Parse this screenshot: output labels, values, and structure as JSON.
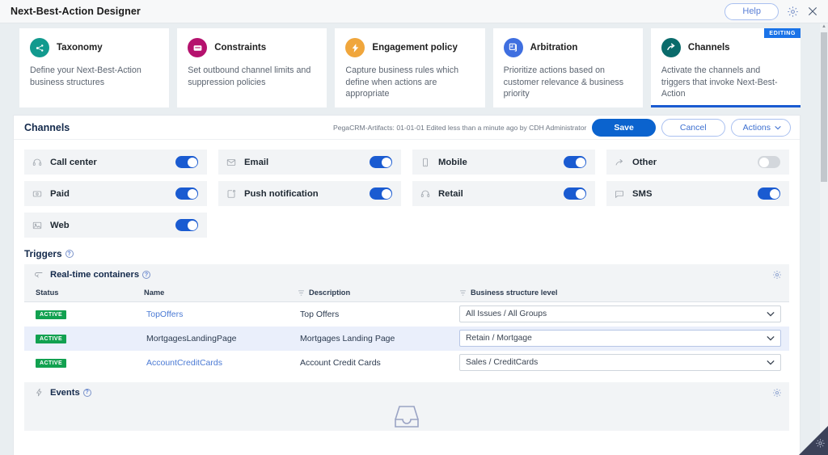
{
  "window": {
    "title": "Next-Best-Action Designer",
    "help_label": "Help",
    "settings_icon": "gear-icon",
    "close_icon": "close-icon"
  },
  "cards": [
    {
      "id": "taxonomy",
      "title": "Taxonomy",
      "description": "Define your Next-Best-Action business structures",
      "icon": "taxonomy-icon",
      "color": "#129a8e",
      "active": false,
      "badge": ""
    },
    {
      "id": "constraints",
      "title": "Constraints",
      "description": "Set outbound channel limits and suppression policies",
      "icon": "constraints-icon",
      "color": "#b5126e",
      "active": false,
      "badge": ""
    },
    {
      "id": "engagement-policy",
      "title": "Engagement policy",
      "description": "Capture business rules which define when actions are appropriate",
      "icon": "bolt-icon",
      "color": "#f0a63c",
      "active": false,
      "badge": ""
    },
    {
      "id": "arbitration",
      "title": "Arbitration",
      "description": "Prioritize actions based on customer relevance & business priority",
      "icon": "arbitration-icon",
      "color": "#3f6fe0",
      "active": false,
      "badge": ""
    },
    {
      "id": "channels",
      "title": "Channels",
      "description": "Activate the channels and triggers that invoke Next-Best-Action",
      "icon": "channels-arrow-icon",
      "color": "#0a6b6b",
      "active": true,
      "badge": "EDITING"
    }
  ],
  "panel": {
    "title": "Channels",
    "meta": "PegaCRM-Artifacts: 01-01-01   Edited less than a minute ago by CDH Administrator",
    "save_label": "Save",
    "cancel_label": "Cancel",
    "actions_label": "Actions"
  },
  "channels": [
    {
      "name": "Call center",
      "icon": "headset-icon",
      "enabled": true
    },
    {
      "name": "Email",
      "icon": "envelope-icon",
      "enabled": true
    },
    {
      "name": "Mobile",
      "icon": "phone-icon",
      "enabled": true
    },
    {
      "name": "Other",
      "icon": "share-icon",
      "enabled": false
    },
    {
      "name": "Paid",
      "icon": "banknote-icon",
      "enabled": true
    },
    {
      "name": "Push notification",
      "icon": "push-icon",
      "enabled": true
    },
    {
      "name": "Retail",
      "icon": "headset-icon",
      "enabled": true
    },
    {
      "name": "SMS",
      "icon": "chat-icon",
      "enabled": true
    },
    {
      "name": "Web",
      "icon": "image-icon",
      "enabled": true
    }
  ],
  "triggers": {
    "heading": "Triggers",
    "realtime": {
      "title": "Real-time containers",
      "icon": "container-icon",
      "gear_icon": "gear-icon",
      "columns": [
        "Status",
        "Name",
        "Description",
        "Business structure level"
      ],
      "rows": [
        {
          "status": "ACTIVE",
          "name": "TopOffers",
          "name_is_link": true,
          "description": "Top Offers",
          "level": "All Issues / All Groups",
          "selected": false
        },
        {
          "status": "ACTIVE",
          "name": "MortgagesLandingPage",
          "name_is_link": false,
          "description": "Mortgages Landing Page",
          "level": "Retain / Mortgage",
          "selected": true
        },
        {
          "status": "ACTIVE",
          "name": "AccountCreditCards",
          "name_is_link": true,
          "description": "Account Credit Cards",
          "level": "Sales / CreditCards",
          "selected": false
        }
      ]
    },
    "events": {
      "title": "Events",
      "icon": "bolt-icon",
      "gear_icon": "gear-icon",
      "empty_icon": "inbox-icon"
    }
  }
}
